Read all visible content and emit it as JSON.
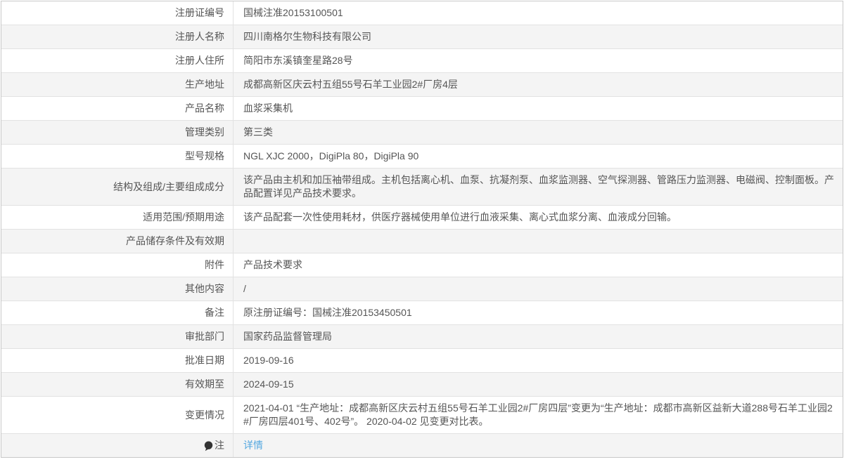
{
  "colors": {
    "text": "#555555",
    "link": "#55a8e0",
    "zebra_stripe": "#f4f4f4",
    "border": "#e2e2e2"
  },
  "table": {
    "rows": [
      {
        "label": "注册证编号",
        "value": "国械注准20153100501"
      },
      {
        "label": "注册人名称",
        "value": "四川南格尔生物科技有限公司"
      },
      {
        "label": "注册人住所",
        "value": "简阳市东溪镇奎星路28号"
      },
      {
        "label": "生产地址",
        "value": "成都高新区庆云村五组55号石羊工业园2#厂房4层"
      },
      {
        "label": "产品名称",
        "value": "血浆采集机"
      },
      {
        "label": "管理类别",
        "value": "第三类"
      },
      {
        "label": "型号规格",
        "value": "NGL XJC 2000，DigiPla 80，DigiPla 90"
      },
      {
        "label": "结构及组成/主要组成成分",
        "value": "该产品由主机和加压袖带组成。主机包括离心机、血泵、抗凝剂泵、血浆监测器、空气探测器、管路压力监测器、电磁阀、控制面板。产品配置详见产品技术要求。"
      },
      {
        "label": "适用范围/预期用途",
        "value": "该产品配套一次性使用耗材，供医疗器械使用单位进行血液采集、离心式血浆分离、血液成分回输。"
      },
      {
        "label": "产品储存条件及有效期",
        "value": ""
      },
      {
        "label": "附件",
        "value": "产品技术要求"
      },
      {
        "label": "其他内容",
        "value": "/"
      },
      {
        "label": "备注",
        "value": "原注册证编号：国械注准20153450501"
      },
      {
        "label": "审批部门",
        "value": "国家药品监督管理局"
      },
      {
        "label": "批准日期",
        "value": "2019-09-16"
      },
      {
        "label": "有效期至",
        "value": "2024-09-15"
      },
      {
        "label": "变更情况",
        "value": "2021-04-01 “生产地址：成都高新区庆云村五组55号石羊工业园2#厂房四层”变更为“生产地址：成都市高新区益新大道288号石羊工业园2#厂房四层401号、402号”。 2020-04-02 见变更对比表。"
      },
      {
        "label": "注",
        "value": "详情",
        "link": true,
        "icon": "note-bubble-icon"
      }
    ]
  }
}
